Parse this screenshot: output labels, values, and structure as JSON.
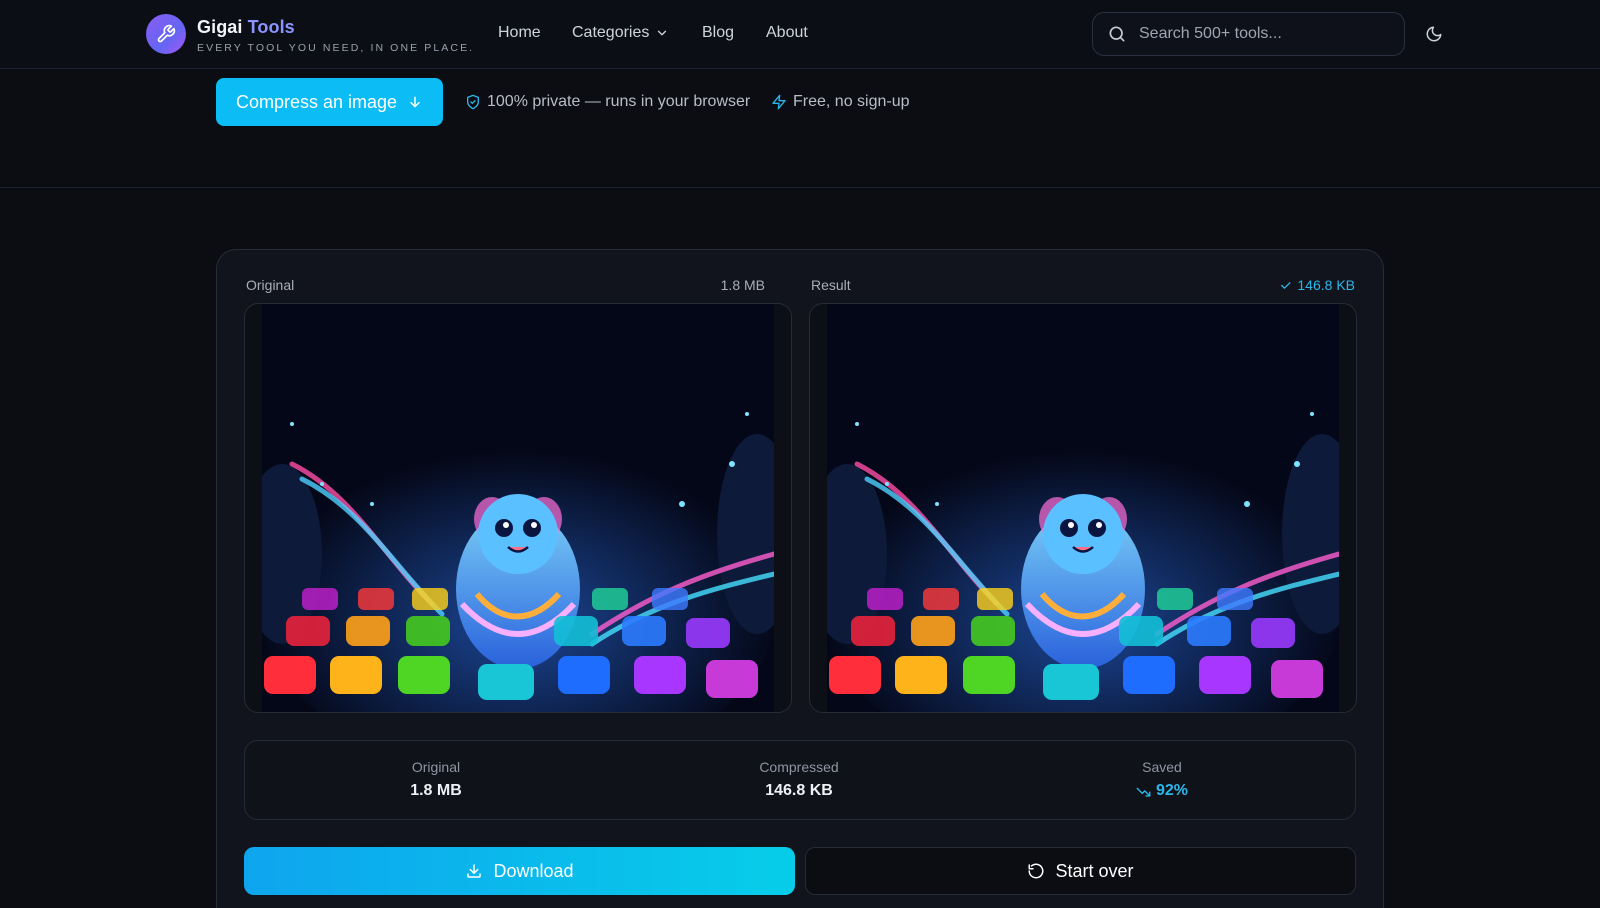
{
  "header": {
    "brand_first": "Gigai",
    "brand_second": "Tools",
    "tagline": "EVERY TOOL YOU NEED, IN ONE PLACE.",
    "nav": [
      {
        "label": "Home"
      },
      {
        "label": "Categories"
      },
      {
        "label": "Blog"
      },
      {
        "label": "About"
      }
    ],
    "search_placeholder": "Search 500+ tools...",
    "icons": {
      "logo": "wrench-icon",
      "search": "search-icon",
      "theme": "moon-icon",
      "dropdown": "chevron-down-icon"
    }
  },
  "hero": {
    "cta_label": "Compress an image",
    "features": [
      {
        "label": "100% private — runs in your browser",
        "icon": "shield-check-icon"
      },
      {
        "label": "Free, no sign-up",
        "icon": "lightning-icon"
      }
    ]
  },
  "compare": {
    "original": {
      "label": "Original",
      "size": "1.8 MB"
    },
    "result": {
      "label": "Result",
      "size": "146.8 KB"
    }
  },
  "stats": [
    {
      "label": "Original",
      "value": "1.8 MB"
    },
    {
      "label": "Compressed",
      "value": "146.8 KB"
    },
    {
      "label": "Saved",
      "value": "92%"
    }
  ],
  "actions": {
    "download_label": "Download",
    "restart_label": "Start over"
  },
  "colors": {
    "accent": "#0bbcf5",
    "saved": "#2db6ea",
    "brand_accent": "#8b93ff"
  }
}
